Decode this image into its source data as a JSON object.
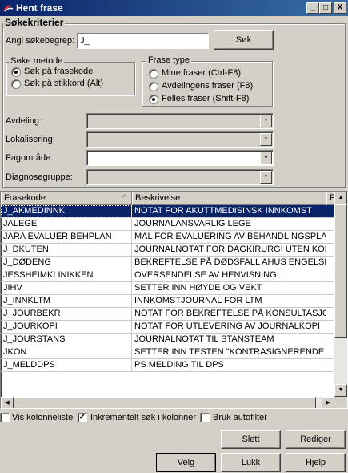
{
  "window": {
    "title": "Hent frase",
    "minimize": "_",
    "maximize": "□",
    "close": "X"
  },
  "criteria": {
    "group_label": "Søkekriterier",
    "search_label": "Angi søkebegrep:",
    "search_value": "J_",
    "search_button": "Søk"
  },
  "method": {
    "group_label": "Søke metode",
    "options": [
      {
        "label": "Søk på frasekode",
        "checked": true
      },
      {
        "label": "Søk på stikkord (Alt)",
        "checked": false
      }
    ]
  },
  "phrase_type": {
    "group_label": "Frase type",
    "options": [
      {
        "label": "Mine fraser (Ctrl-F8)",
        "checked": false
      },
      {
        "label": "Avdelingens fraser (F8)",
        "checked": false
      },
      {
        "label": "Felles fraser (Shift-F8)",
        "checked": true
      }
    ]
  },
  "filters": [
    {
      "label": "Avdeling:",
      "value": "",
      "enabled": false
    },
    {
      "label": "Lokalisering:",
      "value": "",
      "enabled": false
    },
    {
      "label": "Fagområde:",
      "value": "",
      "enabled": true
    },
    {
      "label": "Diagnosegruppe:",
      "value": "",
      "enabled": false
    }
  ],
  "grid": {
    "columns": [
      "Frasekode",
      "Beskrivelse",
      "Fa"
    ],
    "sort_indicator": "^",
    "rows": [
      {
        "code": "J_AKMEDINNK",
        "desc": "NOTAT FOR AKUTTMEDISINSK INNKOMST",
        "selected": true
      },
      {
        "code": "JALEGE",
        "desc": "JOURNALANSVARLIG LEGE",
        "selected": false
      },
      {
        "code": "JARA EVALUER BEHPLAN",
        "desc": "MAL FOR EVALUERING AV BEHANDLINGSPLAN",
        "selected": false
      },
      {
        "code": "J_DKUTEN",
        "desc": "JOURNALNOTAT FOR DAGKIRURGI UTEN KOD",
        "selected": false
      },
      {
        "code": "J_DØDENG",
        "desc": "BEKREFTELSE PÅ DØDSFALL AHUS ENGELSK",
        "selected": false
      },
      {
        "code": "JESSHEIMKLINIKKEN",
        "desc": "OVERSENDELSE AV HENVISNING",
        "selected": false
      },
      {
        "code": "JIHV",
        "desc": "SETTER INN HØYDE OG VEKT",
        "selected": false
      },
      {
        "code": "J_INNKLTM",
        "desc": "INNKOMSTJOURNAL FOR LTM",
        "selected": false
      },
      {
        "code": "J_JOURBEKR",
        "desc": "NOTAT FOR BEKREFTELSE PÅ KONSULTASJO",
        "selected": false
      },
      {
        "code": "J_JOURKOPI",
        "desc": "NOTAT FOR UTLEVERING AV JOURNALKOPI",
        "selected": false
      },
      {
        "code": "J_JOURSTANS",
        "desc": "JOURNALNOTAT TIL STANSTEAM",
        "selected": false
      },
      {
        "code": "JKON",
        "desc": "SETTER INN TESTEN \"KONTRASIGNERENDE",
        "selected": false
      },
      {
        "code": "J_MELDDPS",
        "desc": "PS MELDING TIL DPS",
        "selected": false
      }
    ]
  },
  "options": [
    {
      "label": "Vis kolonneliste",
      "checked": false
    },
    {
      "label": "Inkrementelt søk i kolonner",
      "checked": true
    },
    {
      "label": "Bruk autofilter",
      "checked": false
    }
  ],
  "buttons": {
    "delete": "Slett",
    "edit": "Rediger",
    "choose": "Velg",
    "close": "Lukk",
    "help": "Hjelp"
  },
  "colors": {
    "selection": "#0a246a",
    "titlebar_start": "#0a246a",
    "titlebar_end": "#3a6ea5",
    "face": "#d4d0c8"
  }
}
